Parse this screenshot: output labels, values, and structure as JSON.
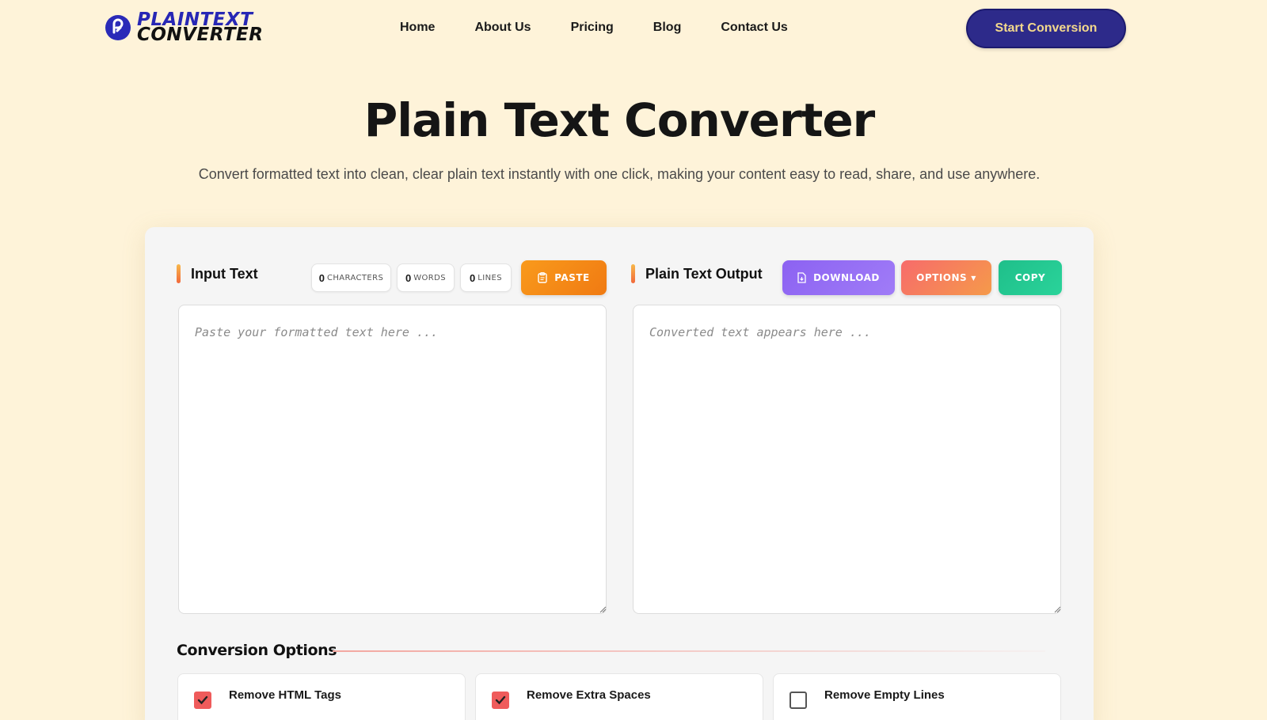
{
  "brand": {
    "line1": "PLAINTEXT",
    "line2": "CONVERTER",
    "logo_icon": "converter-logo-icon"
  },
  "nav": [
    "Home",
    "About Us",
    "Pricing",
    "Blog",
    "Contact Us"
  ],
  "cta": "Start Conversion",
  "hero": {
    "title": "Plain Text Converter",
    "subtitle": "Convert formatted text into clean, clear plain text instantly with one click, making your content easy to read, share, and use anywhere."
  },
  "input": {
    "title": "Input Text",
    "stats": [
      {
        "value": "0",
        "label": "CHARACTERS"
      },
      {
        "value": "0",
        "label": "WORDS"
      },
      {
        "value": "0",
        "label": "LINES"
      }
    ],
    "paste_label": "PASTE",
    "value": "",
    "placeholder": "Paste your formatted text here ..."
  },
  "output": {
    "title": "Plain Text Output",
    "download_label": "DOWNLOAD",
    "options_label": "OPTIONS",
    "copy_label": "COPY",
    "value": "",
    "placeholder": "Converted text appears here ..."
  },
  "options": {
    "title": "Conversion Options",
    "items": [
      {
        "label": "Remove HTML Tags",
        "checked": true
      },
      {
        "label": "Remove Extra Spaces",
        "checked": true
      },
      {
        "label": "Remove Empty Lines",
        "checked": false
      }
    ]
  },
  "colors": {
    "background": "#fef3d9",
    "cta": "#2d2a8a",
    "paste": "#f58a18",
    "download": "#9370f4",
    "options": "#f6795f",
    "copy": "#25c993",
    "checkbox_on": "#ef5b5b"
  }
}
